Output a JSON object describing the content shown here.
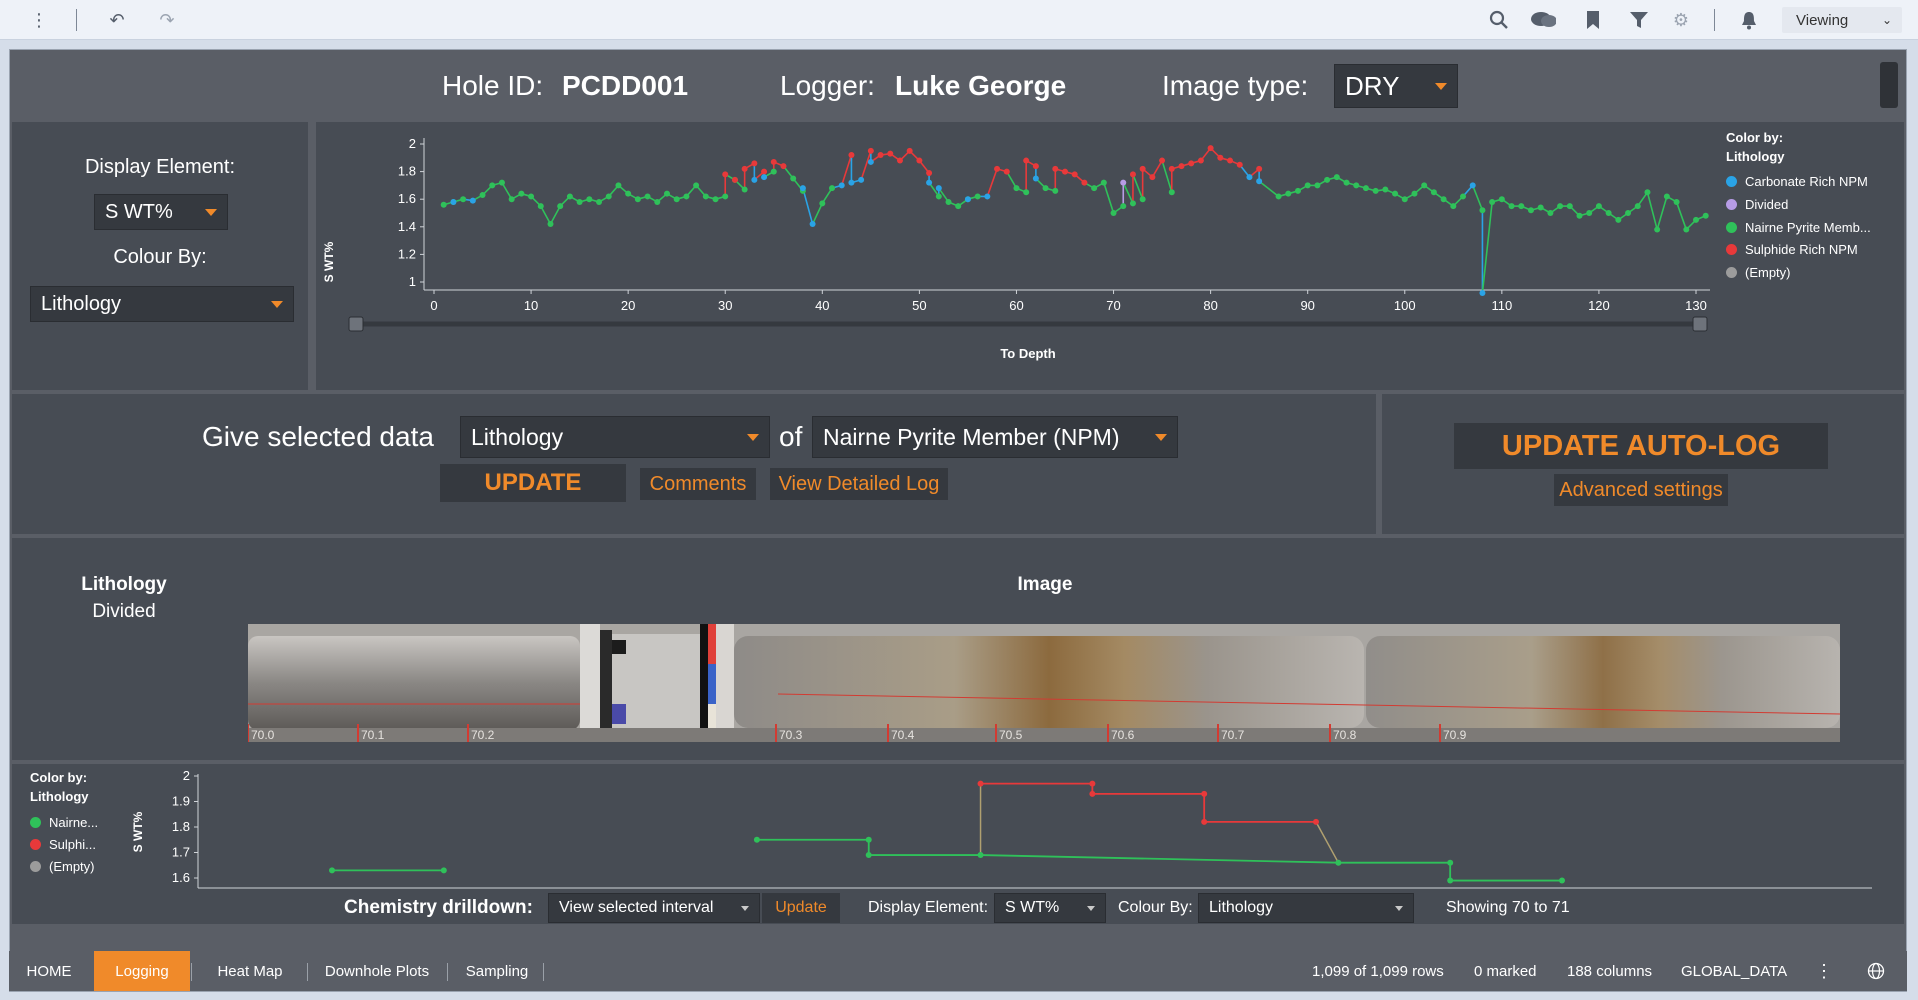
{
  "toolbar": {
    "viewing_label": "Viewing",
    "icons": [
      "more-vertical",
      "undo",
      "redo",
      "search",
      "comments",
      "bookmark",
      "filter",
      "gear",
      "bell"
    ]
  },
  "header": {
    "hole_id_label": "Hole ID:",
    "hole_id": "PCDD001",
    "logger_label": "Logger:",
    "logger": "Luke George",
    "image_type_label": "Image type:",
    "image_type": "DRY"
  },
  "controls": {
    "display_element_label": "Display Element:",
    "display_element": "S WT%",
    "colour_by_label": "Colour By:",
    "colour_by": "Lithology"
  },
  "main_chart": {
    "ylabel": "S WT%",
    "xlabel": "To Depth",
    "legend_title_1": "Color by:",
    "legend_title_2": "Lithology",
    "legend": [
      "Carbonate Rich NPM",
      "Divided",
      "Nairne Pyrite Memb...",
      "Sulphide Rich NPM",
      "(Empty)"
    ]
  },
  "give_data": {
    "label": "Give selected data",
    "field": "Lithology",
    "of_label": "of",
    "value": "Nairne Pyrite Member (NPM)",
    "update_label": "UPDATE",
    "comments_label": "Comments",
    "detailed_log_label": "View Detailed Log"
  },
  "autolog": {
    "label": "UPDATE AUTO-LOG",
    "advanced_label": "Advanced settings"
  },
  "core": {
    "lith_title": "Lithology",
    "lith_value": "Divided",
    "image_title": "Image",
    "depth_marks": [
      "70.0",
      "70.1",
      "70.2",
      "70.3",
      "70.4",
      "70.5",
      "70.6",
      "70.7",
      "70.8",
      "70.9"
    ]
  },
  "detail_chart": {
    "ylabel": "S WT%",
    "legend_title_1": "Color by:",
    "legend_title_2": "Lithology",
    "legend": [
      "Nairne...",
      "Sulphi...",
      "(Empty)"
    ]
  },
  "drilldown": {
    "label": "Chemistry drilldown:",
    "mode": "View selected interval",
    "update_label": "Update",
    "display_element_label": "Display Element:",
    "display_element": "S WT%",
    "colour_by_label": "Colour By:",
    "colour_by": "Lithology",
    "showing": "Showing 70 to 71"
  },
  "tabs": [
    "HOME",
    "Logging",
    "Heat Map",
    "Downhole Plots",
    "Sampling"
  ],
  "status": {
    "rows": "1,099 of 1,099 rows",
    "marked": "0 marked",
    "columns": "188 columns",
    "dataset": "GLOBAL_DATA"
  },
  "colors": {
    "carbonate": "#2aa3e6",
    "divided": "#b79ce6",
    "nairne": "#2fc15a",
    "sulphide": "#e8393a",
    "empty": "#9c9c9c",
    "accent": "#f08a2a"
  },
  "chart_data": [
    {
      "type": "line",
      "ylabel": "S WT%",
      "xlabel": "To Depth",
      "xlim": [
        0,
        130
      ],
      "ylim": [
        0.9,
        2.05
      ],
      "x_ticks": [
        0,
        10,
        20,
        30,
        40,
        50,
        60,
        70,
        80,
        90,
        100,
        110,
        120,
        130
      ],
      "y_ticks": [
        1,
        1.2,
        1.4,
        1.6,
        1.8,
        2
      ],
      "series": [
        {
          "name": "Nairne Pyrite Memb...",
          "color": "#2fc15a",
          "points": [
            [
              1,
              1.56
            ],
            [
              2,
              1.58
            ],
            [
              3,
              1.6
            ],
            [
              5,
              1.63
            ],
            [
              6,
              1.7
            ],
            [
              7,
              1.72
            ],
            [
              8,
              1.6
            ],
            [
              9,
              1.64
            ],
            [
              10,
              1.62
            ],
            [
              11,
              1.55
            ],
            [
              12,
              1.42
            ],
            [
              13,
              1.55
            ],
            [
              14,
              1.62
            ],
            [
              15,
              1.58
            ],
            [
              16,
              1.6
            ],
            [
              17,
              1.58
            ],
            [
              18,
              1.62
            ],
            [
              19,
              1.7
            ],
            [
              20,
              1.64
            ],
            [
              21,
              1.6
            ],
            [
              22,
              1.62
            ],
            [
              23,
              1.58
            ],
            [
              24,
              1.64
            ],
            [
              25,
              1.6
            ],
            [
              26,
              1.62
            ],
            [
              27,
              1.7
            ],
            [
              28,
              1.62
            ],
            [
              29,
              1.6
            ],
            [
              30,
              1.62
            ],
            [
              31,
              1.74
            ],
            [
              32,
              1.67
            ],
            [
              35,
              1.8
            ],
            [
              37,
              1.75
            ],
            [
              38,
              1.66
            ],
            [
              40,
              1.57
            ],
            [
              41,
              1.68
            ],
            [
              52,
              1.62
            ],
            [
              53,
              1.58
            ],
            [
              54,
              1.55
            ],
            [
              55,
              1.6
            ],
            [
              56,
              1.62
            ],
            [
              60,
              1.68
            ],
            [
              61,
              1.65
            ],
            [
              63,
              1.68
            ],
            [
              64,
              1.66
            ],
            [
              68,
              1.68
            ],
            [
              69,
              1.72
            ],
            [
              70,
              1.5
            ],
            [
              71,
              1.55
            ],
            [
              72,
              1.57
            ],
            [
              73,
              1.6
            ],
            [
              76,
              1.65
            ],
            [
              87,
              1.62
            ],
            [
              88,
              1.64
            ],
            [
              89,
              1.66
            ],
            [
              90,
              1.7
            ],
            [
              91,
              1.7
            ],
            [
              92,
              1.74
            ],
            [
              93,
              1.76
            ],
            [
              94,
              1.72
            ],
            [
              95,
              1.7
            ],
            [
              96,
              1.68
            ],
            [
              97,
              1.66
            ],
            [
              98,
              1.67
            ],
            [
              99,
              1.64
            ],
            [
              100,
              1.6
            ],
            [
              101,
              1.64
            ],
            [
              102,
              1.7
            ],
            [
              103,
              1.65
            ],
            [
              104,
              1.6
            ],
            [
              105,
              1.55
            ],
            [
              106,
              1.62
            ],
            [
              108,
              1.52
            ],
            [
              109,
              1.58
            ],
            [
              110,
              1.6
            ],
            [
              111,
              1.55
            ],
            [
              112,
              1.55
            ],
            [
              113,
              1.52
            ],
            [
              114,
              1.54
            ],
            [
              115,
              1.5
            ],
            [
              116,
              1.55
            ],
            [
              117,
              1.55
            ],
            [
              118,
              1.48
            ],
            [
              119,
              1.5
            ],
            [
              120,
              1.55
            ],
            [
              121,
              1.5
            ],
            [
              122,
              1.45
            ],
            [
              123,
              1.5
            ],
            [
              124,
              1.55
            ],
            [
              125,
              1.65
            ],
            [
              126,
              1.38
            ],
            [
              127,
              1.62
            ],
            [
              128,
              1.58
            ],
            [
              129,
              1.38
            ],
            [
              130,
              1.45
            ],
            [
              131,
              1.48
            ]
          ]
        },
        {
          "name": "Sulphide Rich NPM",
          "color": "#e8393a",
          "points": [
            [
              30,
              1.78
            ],
            [
              31,
              1.74
            ],
            [
              32,
              1.82
            ],
            [
              33,
              1.86
            ],
            [
              34,
              1.8
            ],
            [
              35,
              1.87
            ],
            [
              36,
              1.84
            ],
            [
              43,
              1.92
            ],
            [
              45,
              1.95
            ],
            [
              46,
              1.92
            ],
            [
              47,
              1.93
            ],
            [
              48,
              1.88
            ],
            [
              49,
              1.95
            ],
            [
              50,
              1.88
            ],
            [
              51,
              1.79
            ],
            [
              58,
              1.82
            ],
            [
              59,
              1.8
            ],
            [
              61,
              1.88
            ],
            [
              62,
              1.84
            ],
            [
              64,
              1.82
            ],
            [
              65,
              1.8
            ],
            [
              66,
              1.78
            ],
            [
              67,
              1.72
            ],
            [
              72,
              1.78
            ],
            [
              73,
              1.82
            ],
            [
              74,
              1.76
            ],
            [
              75,
              1.88
            ],
            [
              76,
              1.82
            ],
            [
              77,
              1.84
            ],
            [
              78,
              1.86
            ],
            [
              79,
              1.88
            ],
            [
              80,
              1.97
            ],
            [
              81,
              1.9
            ],
            [
              82,
              1.88
            ],
            [
              83,
              1.85
            ],
            [
              85,
              1.82
            ]
          ]
        },
        {
          "name": "Carbonate Rich NPM",
          "color": "#2aa3e6",
          "points": [
            [
              2,
              1.58
            ],
            [
              4,
              1.59
            ],
            [
              33,
              1.74
            ],
            [
              34,
              1.76
            ],
            [
              38,
              1.68
            ],
            [
              39,
              1.42
            ],
            [
              42,
              1.7
            ],
            [
              43,
              1.72
            ],
            [
              44,
              1.74
            ],
            [
              45,
              1.87
            ],
            [
              51,
              1.72
            ],
            [
              52,
              1.68
            ],
            [
              55,
              1.6
            ],
            [
              57,
              1.62
            ],
            [
              62,
              1.75
            ],
            [
              84,
              1.76
            ],
            [
              85,
              1.73
            ],
            [
              107,
              1.7
            ],
            [
              108,
              0.92
            ]
          ]
        },
        {
          "name": "Divided",
          "color": "#b79ce6",
          "points": [
            [
              71,
              1.72
            ]
          ]
        }
      ]
    },
    {
      "type": "line",
      "ylabel": "S WT%",
      "ylim": [
        1.55,
        2.05
      ],
      "y_ticks": [
        1.6,
        1.7,
        1.8,
        1.9,
        2
      ],
      "series": [
        {
          "name": "Nairne...",
          "color": "#2fc15a",
          "points": [
            [
              70.1,
              1.63
            ],
            [
              70.2,
              1.63
            ],
            [
              70.48,
              1.75
            ],
            [
              70.58,
              1.75
            ],
            [
              70.58,
              1.69
            ],
            [
              70.68,
              1.69
            ],
            [
              71.0,
              1.66
            ],
            [
              71.1,
              1.66
            ],
            [
              71.1,
              1.59
            ],
            [
              71.2,
              1.59
            ]
          ]
        },
        {
          "name": "Sulphi...",
          "color": "#e8393a",
          "points": [
            [
              70.68,
              1.97
            ],
            [
              70.78,
              1.97
            ],
            [
              70.78,
              1.93
            ],
            [
              70.88,
              1.93
            ],
            [
              70.88,
              1.82
            ],
            [
              70.98,
              1.82
            ]
          ]
        },
        {
          "name": "(Empty)",
          "color": "#9c9c9c",
          "points": []
        }
      ]
    }
  ]
}
